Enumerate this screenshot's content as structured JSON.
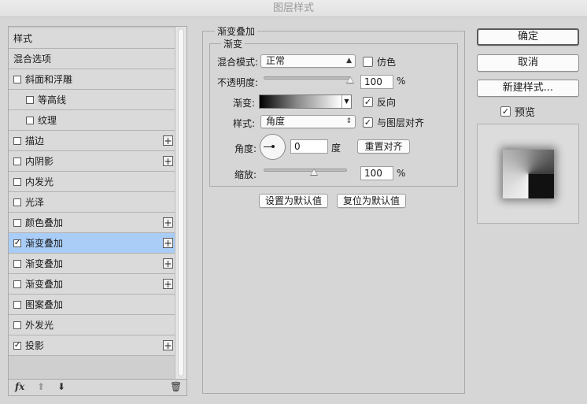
{
  "window": {
    "title": "图层样式"
  },
  "style_list": {
    "items": [
      {
        "label": "样式",
        "checkbox": false,
        "checked": false,
        "plus": false,
        "indent": 0,
        "selected": false
      },
      {
        "label": "混合选项",
        "checkbox": false,
        "checked": false,
        "plus": false,
        "indent": 0,
        "selected": false
      },
      {
        "label": "斜面和浮雕",
        "checkbox": true,
        "checked": false,
        "plus": false,
        "indent": 0,
        "selected": false
      },
      {
        "label": "等高线",
        "checkbox": true,
        "checked": false,
        "plus": false,
        "indent": 1,
        "selected": false
      },
      {
        "label": "纹理",
        "checkbox": true,
        "checked": false,
        "plus": false,
        "indent": 1,
        "selected": false
      },
      {
        "label": "描边",
        "checkbox": true,
        "checked": false,
        "plus": true,
        "indent": 0,
        "selected": false
      },
      {
        "label": "内阴影",
        "checkbox": true,
        "checked": false,
        "plus": true,
        "indent": 0,
        "selected": false
      },
      {
        "label": "内发光",
        "checkbox": true,
        "checked": false,
        "plus": false,
        "indent": 0,
        "selected": false
      },
      {
        "label": "光泽",
        "checkbox": true,
        "checked": false,
        "plus": false,
        "indent": 0,
        "selected": false
      },
      {
        "label": "颜色叠加",
        "checkbox": true,
        "checked": false,
        "plus": true,
        "indent": 0,
        "selected": false
      },
      {
        "label": "渐变叠加",
        "checkbox": true,
        "checked": true,
        "plus": true,
        "indent": 0,
        "selected": true
      },
      {
        "label": "渐变叠加",
        "checkbox": true,
        "checked": false,
        "plus": true,
        "indent": 0,
        "selected": false
      },
      {
        "label": "渐变叠加",
        "checkbox": true,
        "checked": false,
        "plus": true,
        "indent": 0,
        "selected": false
      },
      {
        "label": "图案叠加",
        "checkbox": true,
        "checked": false,
        "plus": false,
        "indent": 0,
        "selected": false
      },
      {
        "label": "外发光",
        "checkbox": true,
        "checked": false,
        "plus": false,
        "indent": 0,
        "selected": false
      },
      {
        "label": "投影",
        "checkbox": true,
        "checked": true,
        "plus": true,
        "indent": 0,
        "selected": false
      }
    ],
    "footer": {
      "fx": "fx",
      "up": "⬆",
      "down": "⬇",
      "trash": "🗑"
    }
  },
  "gradient_overlay": {
    "section_title": "渐变叠加",
    "group_title": "渐变",
    "blend_mode": {
      "label": "混合模式:",
      "value": "正常"
    },
    "dither": {
      "label": "仿色",
      "checked": false
    },
    "opacity": {
      "label": "不透明度:",
      "value": "100",
      "unit": "%",
      "level": 1.0
    },
    "gradient": {
      "label": "渐变:"
    },
    "reverse": {
      "label": "反向",
      "checked": true
    },
    "style": {
      "label": "样式:",
      "value": "角度"
    },
    "align_with_layer": {
      "label": "与图层对齐",
      "checked": true
    },
    "angle": {
      "label": "角度:",
      "value": "0",
      "unit": "度"
    },
    "reset_alignment": "重置对齐",
    "scale": {
      "label": "缩放:",
      "value": "100",
      "unit": "%",
      "level": 0.6
    },
    "make_default": "设置为默认值",
    "reset_default": "复位为默认值"
  },
  "actions": {
    "ok": "确定",
    "cancel": "取消",
    "new_style": "新建样式...",
    "preview": {
      "label": "预览",
      "checked": true
    }
  }
}
